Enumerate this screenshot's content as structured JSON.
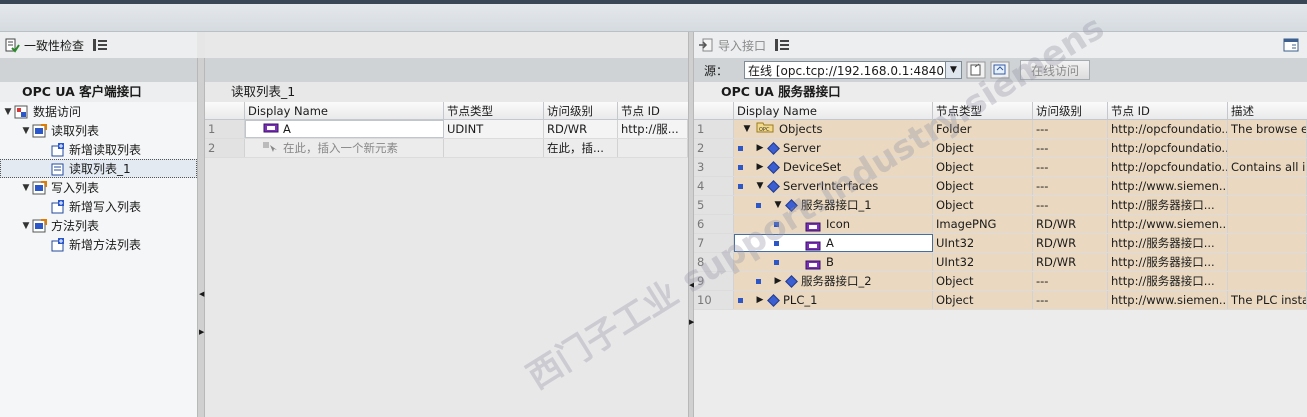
{
  "left": {
    "toolbar": {
      "consistency_check": "一致性检查"
    },
    "section_title": "OPC UA 客户端接口",
    "tree": [
      {
        "label": "数据访问",
        "indent": 0,
        "expander": "▼"
      },
      {
        "label": "读取列表",
        "indent": 1,
        "expander": "▼"
      },
      {
        "label": "新增读取列表",
        "indent": 2,
        "expander": ""
      },
      {
        "label": "读取列表_1",
        "indent": 2,
        "expander": ""
      },
      {
        "label": "写入列表",
        "indent": 1,
        "expander": "▼"
      },
      {
        "label": "新增写入列表",
        "indent": 2,
        "expander": ""
      },
      {
        "label": "方法列表",
        "indent": 1,
        "expander": "▼"
      },
      {
        "label": "新增方法列表",
        "indent": 2,
        "expander": ""
      }
    ]
  },
  "middle": {
    "title": "读取列表_1",
    "columns": [
      "Display Name",
      "节点类型",
      "访问级别",
      "节点 ID"
    ],
    "rows": [
      {
        "num": "1",
        "name": "A",
        "type": "UDINT",
        "access": "RD/WR",
        "nodeid": "http://服..."
      },
      {
        "num": "2",
        "name": "在此，插入一个新元素",
        "type": "",
        "access": "在此，插...",
        "nodeid": ""
      }
    ]
  },
  "right": {
    "toolbar": {
      "import_label": "导入接口"
    },
    "source_label": "源：",
    "source_value": "在线 [opc.tcp://192.168.0.1:4840]",
    "online_button": "在线访问",
    "section_title": "OPC UA 服务器接口",
    "columns": [
      "Display Name",
      "节点类型",
      "访问级别",
      "节点 ID",
      "描述"
    ],
    "rows": [
      {
        "num": "1",
        "name": "Objects",
        "icon": "opc-folder",
        "indent": 0,
        "exp": "▼",
        "type": "Folder",
        "access": "---",
        "nodeid": "http://opcfoundatio...",
        "desc": "The browse e..."
      },
      {
        "num": "2",
        "name": "Server",
        "icon": "object",
        "indent": 1,
        "exp": "▶",
        "type": "Object",
        "access": "---",
        "nodeid": "http://opcfoundatio...",
        "desc": ""
      },
      {
        "num": "3",
        "name": "DeviceSet",
        "icon": "object",
        "indent": 1,
        "exp": "▶",
        "type": "Object",
        "access": "---",
        "nodeid": "http://opcfoundatio...",
        "desc": "Contains all i..."
      },
      {
        "num": "4",
        "name": "ServerInterfaces",
        "icon": "object",
        "indent": 1,
        "exp": "▼",
        "type": "Object",
        "access": "---",
        "nodeid": "http://www.siemen...",
        "desc": ""
      },
      {
        "num": "5",
        "name": "服务器接口_1",
        "icon": "object",
        "indent": 2,
        "exp": "▼",
        "type": "Object",
        "access": "---",
        "nodeid": "http://服务器接口...",
        "desc": ""
      },
      {
        "num": "6",
        "name": "Icon",
        "icon": "variable",
        "indent": 3,
        "exp": "",
        "type": "ImagePNG",
        "access": "RD/WR",
        "nodeid": "http://www.siemen...",
        "desc": ""
      },
      {
        "num": "7",
        "name": "A",
        "icon": "variable",
        "indent": 3,
        "exp": "",
        "type": "UInt32",
        "access": "RD/WR",
        "nodeid": "http://服务器接口...",
        "desc": ""
      },
      {
        "num": "8",
        "name": "B",
        "icon": "variable",
        "indent": 3,
        "exp": "",
        "type": "UInt32",
        "access": "RD/WR",
        "nodeid": "http://服务器接口...",
        "desc": ""
      },
      {
        "num": "9",
        "name": "服务器接口_2",
        "icon": "object",
        "indent": 2,
        "exp": "▶",
        "type": "Object",
        "access": "---",
        "nodeid": "http://服务器接口...",
        "desc": ""
      },
      {
        "num": "10",
        "name": "PLC_1",
        "icon": "object",
        "indent": 1,
        "exp": "▶",
        "type": "Object",
        "access": "---",
        "nodeid": "http://www.siemen...",
        "desc": "The PLC insta..."
      }
    ]
  },
  "watermark": "西门子工业 support.industry.siemens"
}
